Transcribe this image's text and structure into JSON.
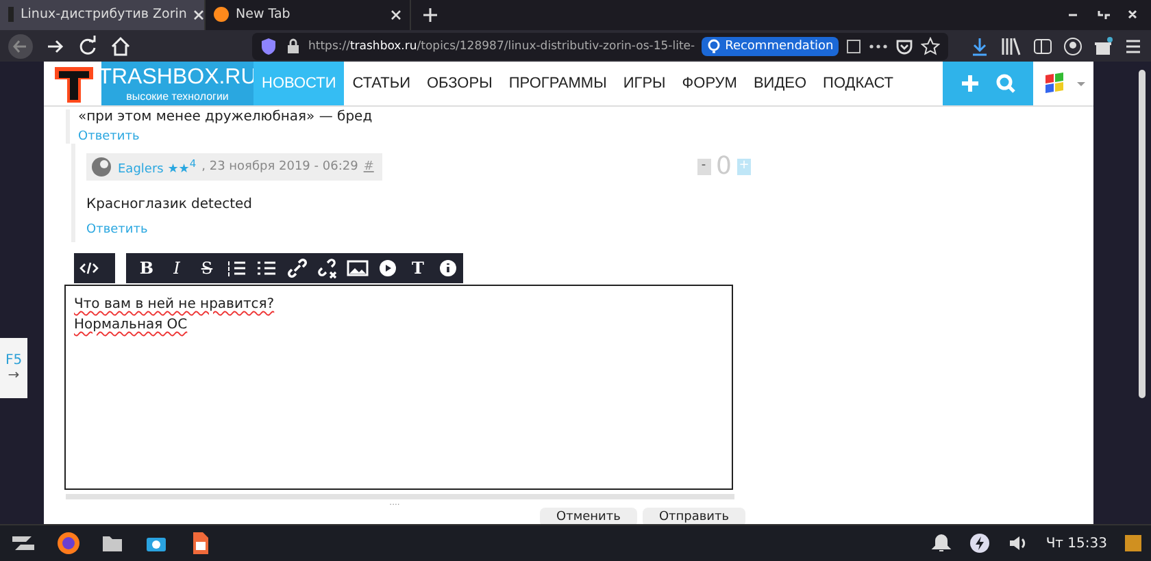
{
  "browser": {
    "tabs": [
      {
        "title": "Linux-дистрибутив Zorin",
        "selected": true
      },
      {
        "title": "New Tab",
        "selected": false
      }
    ],
    "url": {
      "scheme": "https://",
      "host": "trashbox.ru",
      "path": "/topics/128987/linux-distributiv-zorin-os-15-lite-"
    },
    "recommendation": "Recommendation"
  },
  "site": {
    "logo_title": "TRASHBOX.RU",
    "logo_subtitle": "высокие технологии",
    "nav": [
      {
        "label": "НОВОСТИ",
        "selected": true
      },
      {
        "label": "СТАТЬИ",
        "selected": false
      },
      {
        "label": "ОБЗОРЫ",
        "selected": false
      },
      {
        "label": "ПРОГРАММЫ",
        "selected": false
      },
      {
        "label": "ИГРЫ",
        "selected": false
      },
      {
        "label": "ФОРУМ",
        "selected": false
      },
      {
        "label": "ВИДЕО",
        "selected": false
      },
      {
        "label": "ПОДКАСТ",
        "selected": false
      }
    ]
  },
  "comments": {
    "previous_text": "«при этом менее дружелюбная» — бред",
    "previous_reply": "Ответить",
    "comment": {
      "author": "Eaglers",
      "rank": "★★$^{4}$",
      "date": ", 23 ноября 2019 - 06:29",
      "anchor": "#",
      "minus": "-",
      "score": "0",
      "plus": "+",
      "text": "Красноглазик detected",
      "reply": "Ответить"
    }
  },
  "editor": {
    "toolbar": [
      {
        "kind": "code"
      },
      {
        "kind": "char",
        "label": "B"
      },
      {
        "kind": "char",
        "label": "I"
      },
      {
        "kind": "char",
        "label": "S"
      },
      {
        "kind": "ol"
      },
      {
        "kind": "ul"
      },
      {
        "kind": "link"
      },
      {
        "kind": "unlink"
      },
      {
        "kind": "image"
      },
      {
        "kind": "play"
      },
      {
        "kind": "char",
        "label": "T"
      },
      {
        "kind": "info"
      }
    ],
    "lines": [
      "Что вам в ней не нравится?",
      "Нормальная ОС"
    ],
    "grip": "....",
    "buttons": [
      "Отменить",
      "Отправить"
    ]
  },
  "side_tab": {
    "key": "F5",
    "arrow": "→"
  },
  "taskbar": {
    "clock": "Чт 15:33"
  }
}
